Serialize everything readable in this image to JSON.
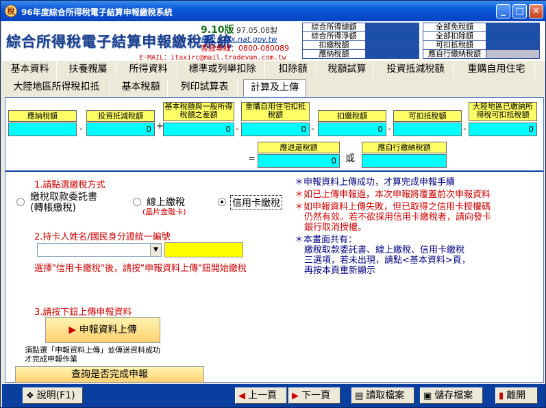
{
  "window": {
    "title": "96年度綜合所得稅電子結算申報繳稅系統",
    "icon_char": "稅",
    "min": "_",
    "max": "□",
    "close": "✕"
  },
  "header": {
    "logo": "綜合所得稅電子結算申報繳稅系統",
    "version": "9.10版",
    "version_date": "97.05.08製",
    "site_label": "網址：tax.nat.gov.tw",
    "service": "客服專線：0800-080089",
    "email": "E-MAIL：itaxirc@mail.tradevan.com.tw",
    "summary_left": [
      {
        "label": "綜合所得總額"
      },
      {
        "label": "綜合所得淨額"
      },
      {
        "label": "扣繳稅額"
      },
      {
        "label": "應納稅額"
      }
    ],
    "summary_right": [
      {
        "label": "全部免稅額"
      },
      {
        "label": "全部扣除額"
      },
      {
        "label": "可扣抵稅額"
      },
      {
        "label": "應自行繳納稅額"
      }
    ]
  },
  "tabs_row1": [
    "基本資料",
    "扶養親屬",
    "所得資料",
    "標準或列舉扣除",
    "扣除額",
    "稅額試算",
    "投資抵減稅額",
    "重購自用住宅"
  ],
  "tabs_row2": [
    "大陸地區所得稅扣抵",
    "基本稅額",
    "列印試算表",
    "計算及上傳"
  ],
  "calc": {
    "l1": "應納稅額",
    "l2": "投資抵減稅額",
    "l3": "基本稅額與一般所得稅額之差額",
    "l4": "重購自用住宅扣抵稅額",
    "l5": "扣繳稅額",
    "l6": "可扣抵稅額",
    "l7": "大陸地區已繳納所得稅可扣抵稅額",
    "v2": "0",
    "v3": "0",
    "v4": "0",
    "v5": "0",
    "v7": "0",
    "minus": "-",
    "plus": "+",
    "equals": "=",
    "or": "或",
    "refund_label": "應退還稅額",
    "refund_value": "0",
    "selfpay_label": "應自行繳納稅額"
  },
  "step1": {
    "title": "1.請點選繳稅方式",
    "opt1_a": "繳稅取款委託書",
    "opt1_b": "(轉帳繳稅)",
    "opt2": "線上繳稅",
    "opt2_sub": "(晶片金融卡)",
    "opt3": "信用卡繳稅"
  },
  "step2": {
    "title": "2.持卡人姓名/國民身分證統一編號",
    "hint": "選擇\"信用卡繳稅\"後，請按\"申報資料上傳\"鈕開始繳稅"
  },
  "notes": {
    "n1": "＊申報資料上傳成功，才算完成申報手續",
    "n2": "＊如已上傳申報過，本次申報將覆蓋前次申報資料",
    "n3a": "＊如申報資料上傳失敗，但已取得之信用卡授權碼",
    "n3b": "仍然有效。若不欲採用信用卡繳稅者，請向發卡",
    "n3c": "銀行取消授權。",
    "n4a": "＊本畫面共有：",
    "n4b": "繳稅取款委託書、線上繳稅、信用卡繳稅",
    "n4c": "三選項，若未出現，請點<基本資料>頁，",
    "n4d": "再按本頁重新顯示"
  },
  "step3": {
    "title": "3.請按下鈕上傳申報資料",
    "button": "申報資料上傳",
    "note_a": "須點選「申報資料上傳」並傳送資料成功",
    "note_b": "才完成申報作業",
    "check_button": "查詢是否完成申報"
  },
  "bottom": {
    "help": "說明(F1)",
    "prev": "上一頁",
    "next": "下一頁",
    "load": "讀取檔案",
    "save": "儲存檔案",
    "exit": "離開"
  }
}
